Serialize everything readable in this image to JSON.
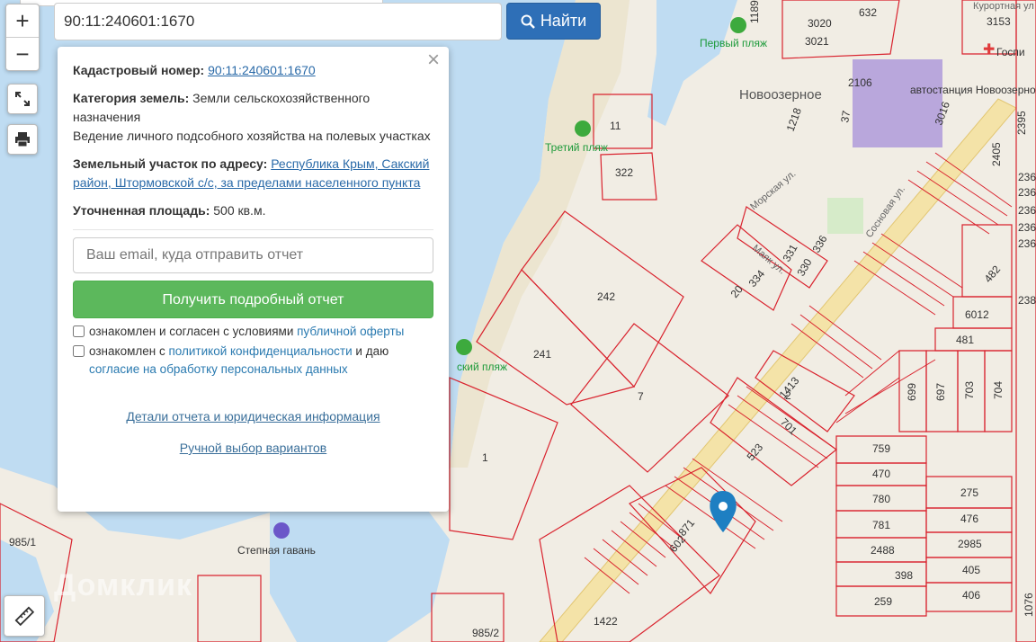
{
  "search": {
    "value": "90:11:240601:1670",
    "button_label": "Найти"
  },
  "zoom": {
    "in": "+",
    "out": "−"
  },
  "popup": {
    "cadastral_label": "Кадастровый номер:",
    "cadastral_value": "90:11:240601:1670",
    "category_label": "Категория земель:",
    "category_value": "Земли сельскохозяйственного назначения",
    "usage": "Ведение личного подсобного хозяйства на полевых участках",
    "address_label": "Земельный участок по адресу:",
    "address_value": "Республика Крым, Сакский район, Штормовской с/с, за пределами населенного пункта",
    "area_label": "Уточненная площадь:",
    "area_value": "500 кв.м.",
    "email_placeholder": "Ваш email, куда отправить отчет",
    "report_button": "Получить подробный отчет",
    "consent1_text": "ознакомлен и согласен с условиями",
    "consent1_link": "публичной оферты",
    "consent2_text": "ознакомлен с",
    "consent2_link": "политикой конфиденциальности",
    "consent2_mid": "и даю",
    "consent2_link2": "согласие на обработку персональных данных",
    "details_link": "Детали отчета и юридическая информация",
    "manual_link": "Ручной выбор вариантов",
    "close": "×"
  },
  "map": {
    "places": {
      "beach1": "Первый пляж",
      "beach3": "Третий пляж",
      "beach_partial": "ский пляж",
      "town": "Новоозерное",
      "bus": "автостанция Новоозерное",
      "harbor": "Степная гавань",
      "street_morskaya": "Морская ул.",
      "street_sosnovaya": "Сосновая ул.",
      "street_mayak": "Маяк ул.",
      "hosp": "Госпи",
      "resort": "Курортная ул"
    },
    "parcels": [
      "1189",
      "3020",
      "632",
      "3153",
      "3021",
      "2106",
      "1218",
      "37",
      "3016",
      "2395",
      "11",
      "322",
      "2405",
      "236",
      "236",
      "236",
      "236",
      "236",
      "242",
      "331",
      "336",
      "330",
      "334",
      "20",
      "482",
      "238",
      "6012",
      "481",
      "241",
      "7",
      "1413",
      "2",
      "699",
      "697",
      "703",
      "704",
      "701",
      "523",
      "759",
      "470",
      "1",
      "871",
      "602",
      "780",
      "275",
      "781",
      "476",
      "2488",
      "2985",
      "398",
      "405",
      "259",
      "406",
      "985/1",
      "985/2",
      "1422",
      "1076"
    ],
    "watermark": "Домклик"
  },
  "colors": {
    "parcel": "#d9232e",
    "water": "#bfdcf2",
    "land": "#f1ede4",
    "button_blue": "#2e6fb7",
    "button_green": "#5cb85c"
  }
}
